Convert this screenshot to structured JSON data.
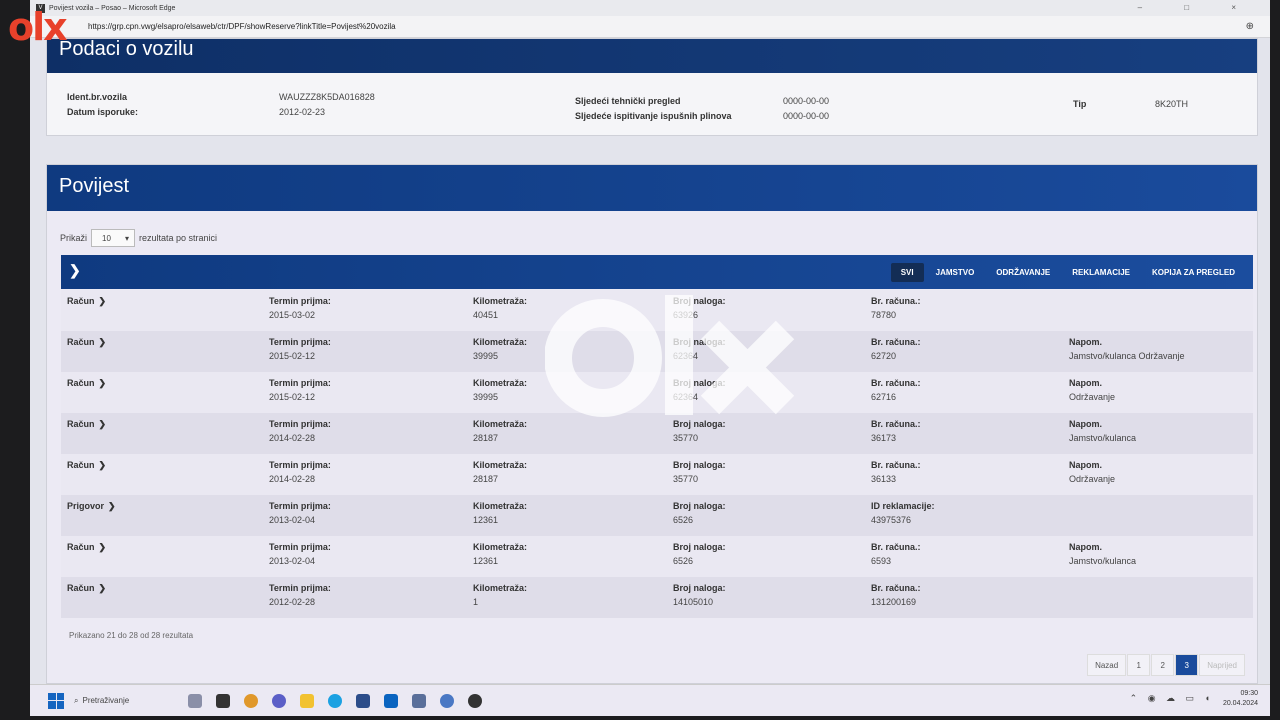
{
  "window": {
    "title": "Povijest vozila – Posao – Microsoft Edge",
    "app_icon_letter": "V",
    "url": "https://grp.cpn.vwg/elsapro/elsaweb/ctr/DPF/showReserve?linkTitle=Povijest%20vozila",
    "controls": "– □ ×"
  },
  "vehicle_panel": {
    "title": "Podaci o vozilu",
    "fields": {
      "vin_label": "Ident.br.vozila",
      "vin": "WAUZZZ8K5DA016828",
      "delivery_label": "Datum isporuke:",
      "delivery": "2012-02-23",
      "inspection_label": "Sljedeći tehnički pregled",
      "inspection": "0000-00-00",
      "emission_label": "Sljedeće ispitivanje ispušnih plinova",
      "emission": "0000-00-00",
      "type_label": "Tip",
      "type": "8K20TH"
    }
  },
  "history_panel": {
    "title": "Povijest",
    "per_page_prefix": "Prikaži",
    "per_page_value": "10",
    "per_page_suffix": "rezultata po stranici",
    "filters": [
      "SVI",
      "JAMSTVO",
      "ODRŽAVANJE",
      "REKLAMACIJE",
      "KOPIJA ZA PREGLED"
    ],
    "active_filter": "SVI",
    "columns": {
      "date": "Termin prijma:",
      "km": "Kilometraža:",
      "order": "Broj naloga:",
      "invoice": "Br. računa.:",
      "claim": "ID reklamacije:",
      "note": "Napom."
    },
    "rows": [
      {
        "type": "Račun",
        "date": "2015-03-02",
        "km": "40451",
        "order": "63926",
        "ref_label": "Br. računa.:",
        "ref": "78780",
        "note_label": "",
        "note": ""
      },
      {
        "type": "Račun",
        "date": "2015-02-12",
        "km": "39995",
        "order": "62364",
        "ref_label": "Br. računa.:",
        "ref": "62720",
        "note_label": "Napom.",
        "note": "Jamstvo/kulanca Održavanje"
      },
      {
        "type": "Račun",
        "date": "2015-02-12",
        "km": "39995",
        "order": "62364",
        "ref_label": "Br. računa.:",
        "ref": "62716",
        "note_label": "Napom.",
        "note": "Održavanje"
      },
      {
        "type": "Račun",
        "date": "2014-02-28",
        "km": "28187",
        "order": "35770",
        "ref_label": "Br. računa.:",
        "ref": "36173",
        "note_label": "Napom.",
        "note": "Jamstvo/kulanca"
      },
      {
        "type": "Račun",
        "date": "2014-02-28",
        "km": "28187",
        "order": "35770",
        "ref_label": "Br. računa.:",
        "ref": "36133",
        "note_label": "Napom.",
        "note": "Održavanje"
      },
      {
        "type": "Prigovor",
        "date": "2013-02-04",
        "km": "12361",
        "order": "6526",
        "ref_label": "ID reklamacije:",
        "ref": "43975376",
        "note_label": "",
        "note": ""
      },
      {
        "type": "Račun",
        "date": "2013-02-04",
        "km": "12361",
        "order": "6526",
        "ref_label": "Br. računa.:",
        "ref": "6593",
        "note_label": "Napom.",
        "note": "Jamstvo/kulanca"
      },
      {
        "type": "Račun",
        "date": "2012-02-28",
        "km": "1",
        "order": "14105010",
        "ref_label": "Br. računa.:",
        "ref": "131200169",
        "note_label": "",
        "note": ""
      }
    ],
    "summary": "Prikazano 21 do 28 od 28 rezultata",
    "pagination": {
      "prev": "Nazad",
      "pages": [
        "1",
        "2",
        "3"
      ],
      "current": "3",
      "next": "Naprijed"
    }
  },
  "taskbar": {
    "search_placeholder": "Pretraživanje",
    "time": "09:30",
    "date": "20.04.2024"
  },
  "watermark_brand": "olx",
  "colors": {
    "header_blue": "#0f3a80",
    "accent_active": "#132d55",
    "olx_red": "#e8412b"
  }
}
